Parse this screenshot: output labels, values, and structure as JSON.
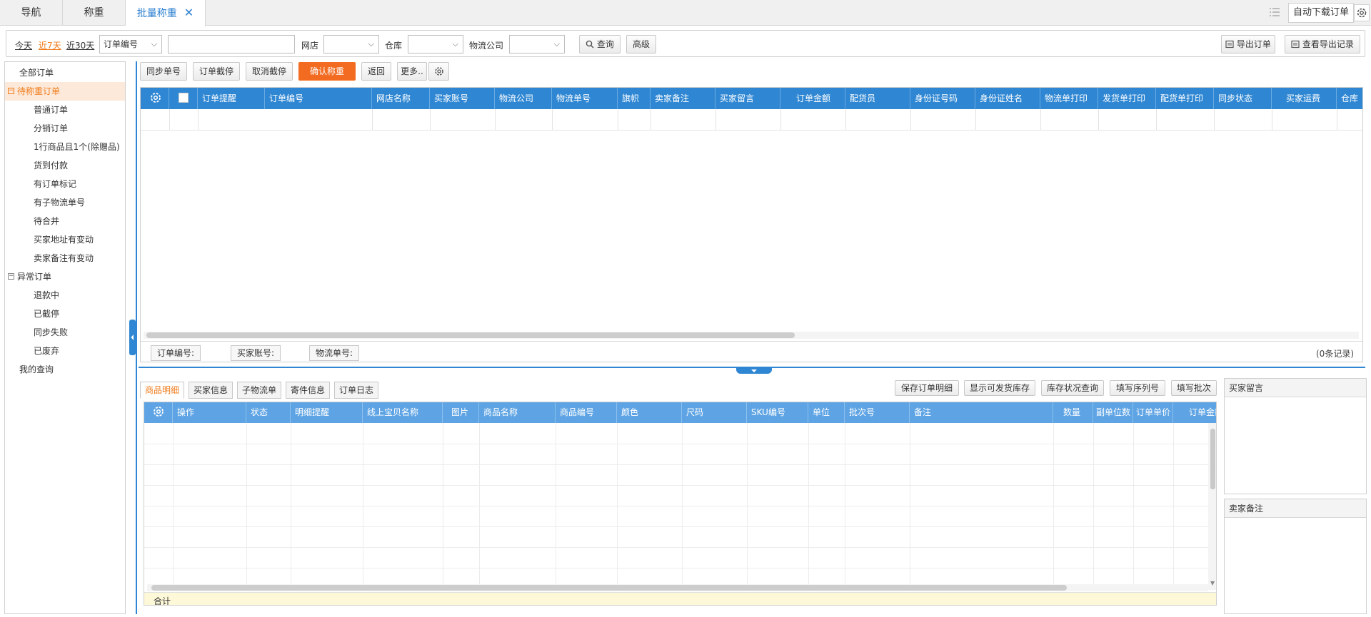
{
  "tabs": [
    {
      "label": "导航"
    },
    {
      "label": "称重"
    },
    {
      "label": "批量称重"
    }
  ],
  "topright": {
    "auto_download": "自动下载订单"
  },
  "filter": {
    "today": "今天",
    "last7": "近7天",
    "last30": "近30天",
    "order_field": "订单编号",
    "search_value": "",
    "shop_label": "网店",
    "warehouse_label": "仓库",
    "logistics_label": "物流公司",
    "query": "查询",
    "advanced": "高级",
    "export_orders": "导出订单",
    "view_export": "查看导出记录"
  },
  "sidebar": {
    "all": "全部订单",
    "pending": "待称重订单",
    "pending_children": [
      "普通订单",
      "分销订单",
      "1行商品且1个(除赠品)",
      "货到付款",
      "有订单标记",
      "有子物流单号",
      "待合并",
      "买家地址有变动",
      "卖家备注有变动"
    ],
    "abnormal": "异常订单",
    "abnormal_children": [
      "退款中",
      "已截停",
      "同步失败",
      "已废弃"
    ],
    "my_query": "我的查询"
  },
  "toolbar": {
    "sync": "同步单号",
    "intercept": "订单截停",
    "cancel_intercept": "取消截停",
    "confirm_weigh": "确认称重",
    "back": "返回",
    "more": "更多.."
  },
  "main_grid": {
    "columns": [
      "订单提醒",
      "订单编号",
      "网店名称",
      "买家账号",
      "物流公司",
      "物流单号",
      "旗帜",
      "卖家备注",
      "买家留言",
      "订单金额",
      "配货员",
      "身份证号码",
      "身份证姓名",
      "物流单打印",
      "发货单打印",
      "配货单打印",
      "同步状态",
      "买家运费",
      "仓库"
    ],
    "footer_tags": [
      "订单编号:",
      "买家账号:",
      "物流单号:"
    ],
    "record_count": "(0条记录)"
  },
  "detail": {
    "tabs": [
      "商品明细",
      "买家信息",
      "子物流单",
      "寄件信息",
      "订单日志"
    ],
    "actions": [
      "保存订单明细",
      "显示可发货库存",
      "库存状况查询",
      "填写序列号",
      "填写批次"
    ],
    "columns": [
      "操作",
      "状态",
      "明细提醒",
      "线上宝贝名称",
      "图片",
      "商品名称",
      "商品编号",
      "颜色",
      "尺码",
      "SKU编号",
      "单位",
      "批次号",
      "备注",
      "数量",
      "副单位数",
      "订单单价",
      "订单金额"
    ],
    "total_label": "合计"
  },
  "side_panels": {
    "buyer_message": "买家留言",
    "seller_note": "卖家备注"
  },
  "colors": {
    "accent_blue": "#2f87d3",
    "orange": "#f26b21"
  }
}
